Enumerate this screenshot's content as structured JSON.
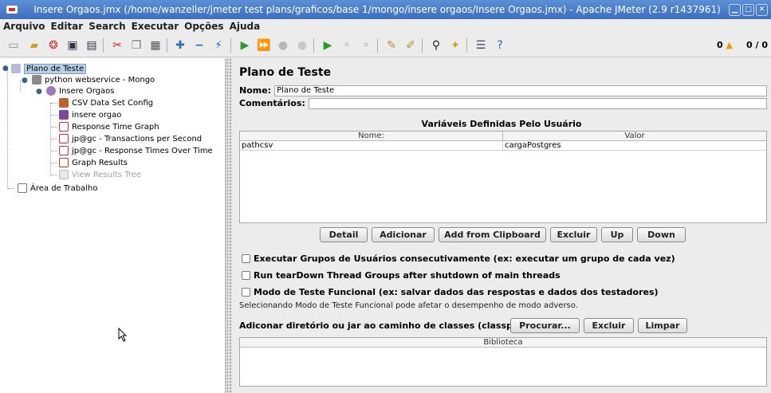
{
  "window": {
    "title": "Insere Orgaos.jmx (/home/wanzeller/jmeter test plans/graficos/base 1/mongo/insere orgaos/Insere Orgaos.jmx) - Apache JMeter (2.9 r1437961)",
    "controls": [
      "minimize-icon",
      "maximize-icon",
      "close-icon"
    ]
  },
  "menu": [
    "Arquivo",
    "Editar",
    "Search",
    "Executar",
    "Opções",
    "Ajuda"
  ],
  "toolbar": {
    "icons": [
      "new-icon",
      "templates-icon",
      "open-icon",
      "save-icon",
      "save-as-icon",
      "cut-icon",
      "copy-icon",
      "paste-icon",
      "expand-icon",
      "collapse-icon",
      "toggle-icon",
      "start-icon",
      "start-no-pause-icon",
      "stop-icon",
      "shutdown-icon",
      "remote-start-icon",
      "remote-stop-icon",
      "remote-shutdown-icon",
      "clear-icon",
      "clear-all-icon",
      "search-icon",
      "reset-search-icon",
      "function-helper-icon",
      "help-icon"
    ],
    "warning_count": "0",
    "thread_counter": "0 / 0"
  },
  "tree": {
    "nodes": [
      {
        "label": "Plano de Teste",
        "icon": "test-plan-icon"
      },
      {
        "label": "python webservice - Mongo",
        "icon": "thread-group-icon"
      },
      {
        "label": "Insere Orgaos",
        "icon": "transaction-controller-icon"
      },
      {
        "label": "CSV Data Set Config",
        "icon": "config-element-icon"
      },
      {
        "label": "insere orgao",
        "icon": "sampler-icon"
      },
      {
        "label": "Response Time Graph",
        "icon": "listener-icon"
      },
      {
        "label": "jp@gc - Transactions per Second",
        "icon": "listener-icon"
      },
      {
        "label": "jp@gc - Response Times Over Time",
        "icon": "listener-icon"
      },
      {
        "label": "Graph Results",
        "icon": "listener-icon"
      },
      {
        "label": "View Results Tree",
        "icon": "listener-icon",
        "disabled": true
      },
      {
        "label": "Área de Trabalho",
        "icon": "workbench-icon"
      }
    ]
  },
  "panel": {
    "title": "Plano de Teste",
    "name_label": "Nome:",
    "name_value": "Plano de Teste",
    "comments_label": "Comentários:",
    "comments_value": "",
    "vars_title": "Variáveis Definidas Pelo Usuário",
    "vars_columns": [
      "Nome:",
      "Valor"
    ],
    "vars_rows": [
      [
        "pathcsv",
        "cargaPostgres"
      ]
    ],
    "buttons": [
      "Detail",
      "Adicionar",
      "Add from Clipboard",
      "Excluir",
      "Up",
      "Down"
    ],
    "checks": [
      {
        "label": "Executar Grupos de Usuários consecutivamente (ex: executar um grupo de cada vez)",
        "checked": false
      },
      {
        "label": "Run tearDown Thread Groups after shutdown of main threads",
        "checked": false
      },
      {
        "label": "Modo de Teste Funcional (ex: salvar dados das respostas e dados dos testadores)",
        "checked": false
      }
    ],
    "functional_note": "Selecionando Modo de Teste Funcional pode afetar o desempenho de modo adverso.",
    "classpath_label": "Adiconar diretório ou jar ao caminho de classes (classpath)",
    "classpath_buttons": [
      "Procurar...",
      "Excluir",
      "Limpar"
    ],
    "library_column": "Biblioteca"
  }
}
